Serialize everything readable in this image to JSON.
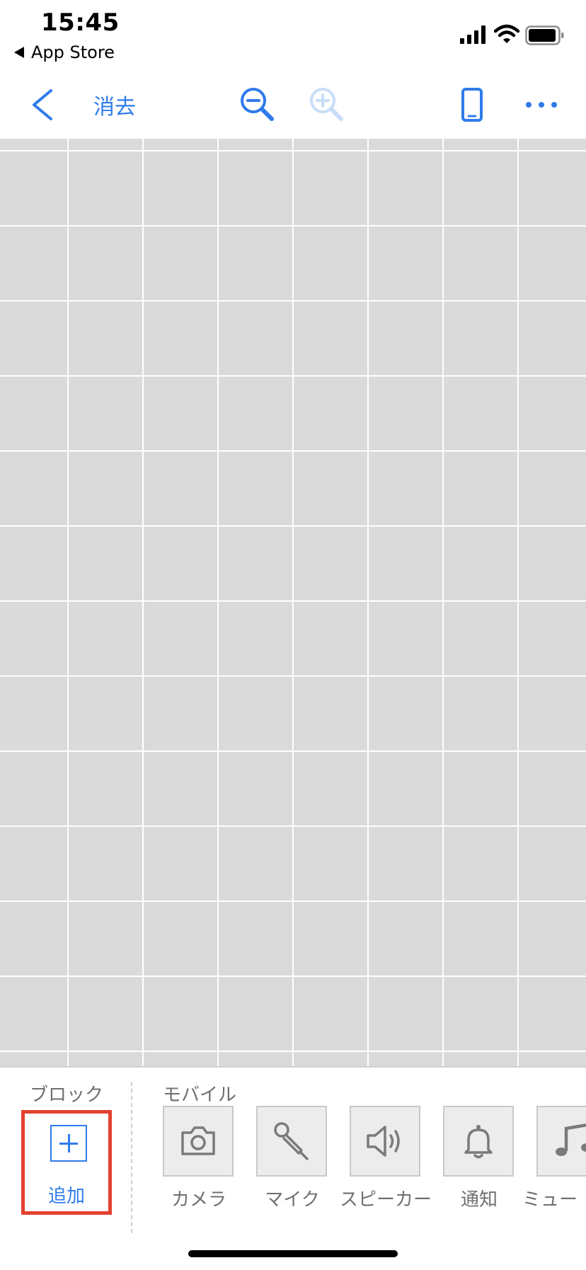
{
  "status_bar": {
    "time": "15:45",
    "back_app_label": "App Store"
  },
  "toolbar": {
    "clear_label": "消去",
    "icons": [
      "back-chevron-icon",
      "zoom-out-icon",
      "zoom-in-icon",
      "phone-device-icon",
      "more-icon"
    ]
  },
  "panel": {
    "block_section_label": "ブロック",
    "add_label": "追加",
    "mobile_section_label": "モバイル",
    "items": [
      {
        "label": "カメラ",
        "icon": "camera-icon"
      },
      {
        "label": "マイク",
        "icon": "microphone-icon"
      },
      {
        "label": "スピーカー",
        "icon": "speaker-icon"
      },
      {
        "label": "通知",
        "icon": "bell-icon"
      },
      {
        "label": "ミュー",
        "icon": "music-note-icon"
      }
    ]
  },
  "colors": {
    "accent": "#2f7bea",
    "highlight": "#e3412f",
    "grid": "#dadada"
  }
}
